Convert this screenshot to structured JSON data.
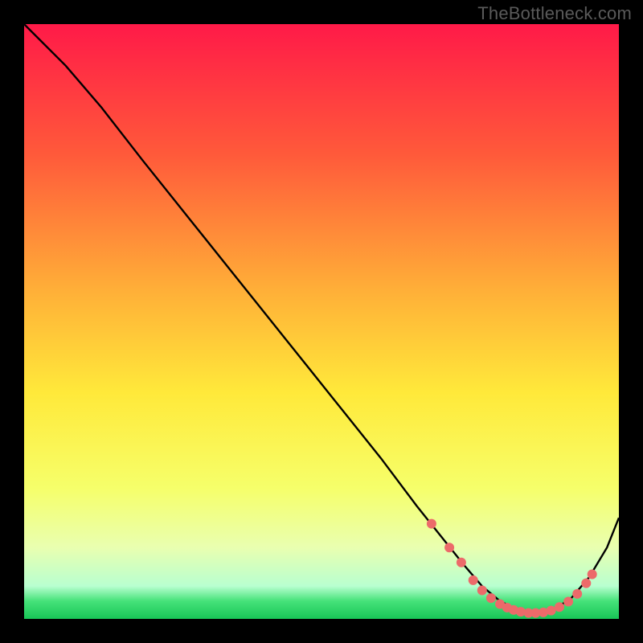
{
  "watermark": "TheBottleneck.com",
  "chart_data": {
    "type": "line",
    "title": "",
    "xlabel": "",
    "ylabel": "",
    "xlim": [
      0,
      100
    ],
    "ylim": [
      0,
      100
    ],
    "grid": false,
    "legend": false,
    "background_gradient_stops": [
      {
        "offset": 0.0,
        "color": "#ff1a48"
      },
      {
        "offset": 0.22,
        "color": "#ff5a3a"
      },
      {
        "offset": 0.45,
        "color": "#ffb038"
      },
      {
        "offset": 0.62,
        "color": "#ffe93a"
      },
      {
        "offset": 0.78,
        "color": "#f6ff6a"
      },
      {
        "offset": 0.88,
        "color": "#e9ffb0"
      },
      {
        "offset": 0.945,
        "color": "#b8ffd0"
      },
      {
        "offset": 0.97,
        "color": "#46e27a"
      },
      {
        "offset": 1.0,
        "color": "#18c657"
      }
    ],
    "series": [
      {
        "name": "curve",
        "color": "#000000",
        "x": [
          0,
          7,
          13,
          20,
          28,
          36,
          44,
          52,
          60,
          66,
          70,
          74,
          77,
          80,
          83,
          86,
          89,
          92,
          95,
          98,
          100
        ],
        "y": [
          100,
          93,
          86,
          77,
          67,
          57,
          47,
          37,
          27,
          19,
          14,
          9,
          5.5,
          3,
          1.5,
          1,
          1.5,
          3.5,
          7,
          12,
          17
        ]
      }
    ],
    "markers": {
      "name": "highlight-dots",
      "color": "#ec6a6a",
      "radius_px": 6,
      "points": [
        {
          "x": 68.5,
          "y": 16
        },
        {
          "x": 71.5,
          "y": 12
        },
        {
          "x": 73.5,
          "y": 9.5
        },
        {
          "x": 75.5,
          "y": 6.5
        },
        {
          "x": 77.0,
          "y": 4.8
        },
        {
          "x": 78.5,
          "y": 3.5
        },
        {
          "x": 80.0,
          "y": 2.5
        },
        {
          "x": 81.2,
          "y": 1.9
        },
        {
          "x": 82.3,
          "y": 1.5
        },
        {
          "x": 83.5,
          "y": 1.2
        },
        {
          "x": 84.8,
          "y": 1.0
        },
        {
          "x": 86.0,
          "y": 1.0
        },
        {
          "x": 87.3,
          "y": 1.1
        },
        {
          "x": 88.6,
          "y": 1.4
        },
        {
          "x": 90.0,
          "y": 2.0
        },
        {
          "x": 91.5,
          "y": 2.9
        },
        {
          "x": 93.0,
          "y": 4.2
        },
        {
          "x": 94.5,
          "y": 6.0
        },
        {
          "x": 95.5,
          "y": 7.5
        }
      ]
    }
  }
}
